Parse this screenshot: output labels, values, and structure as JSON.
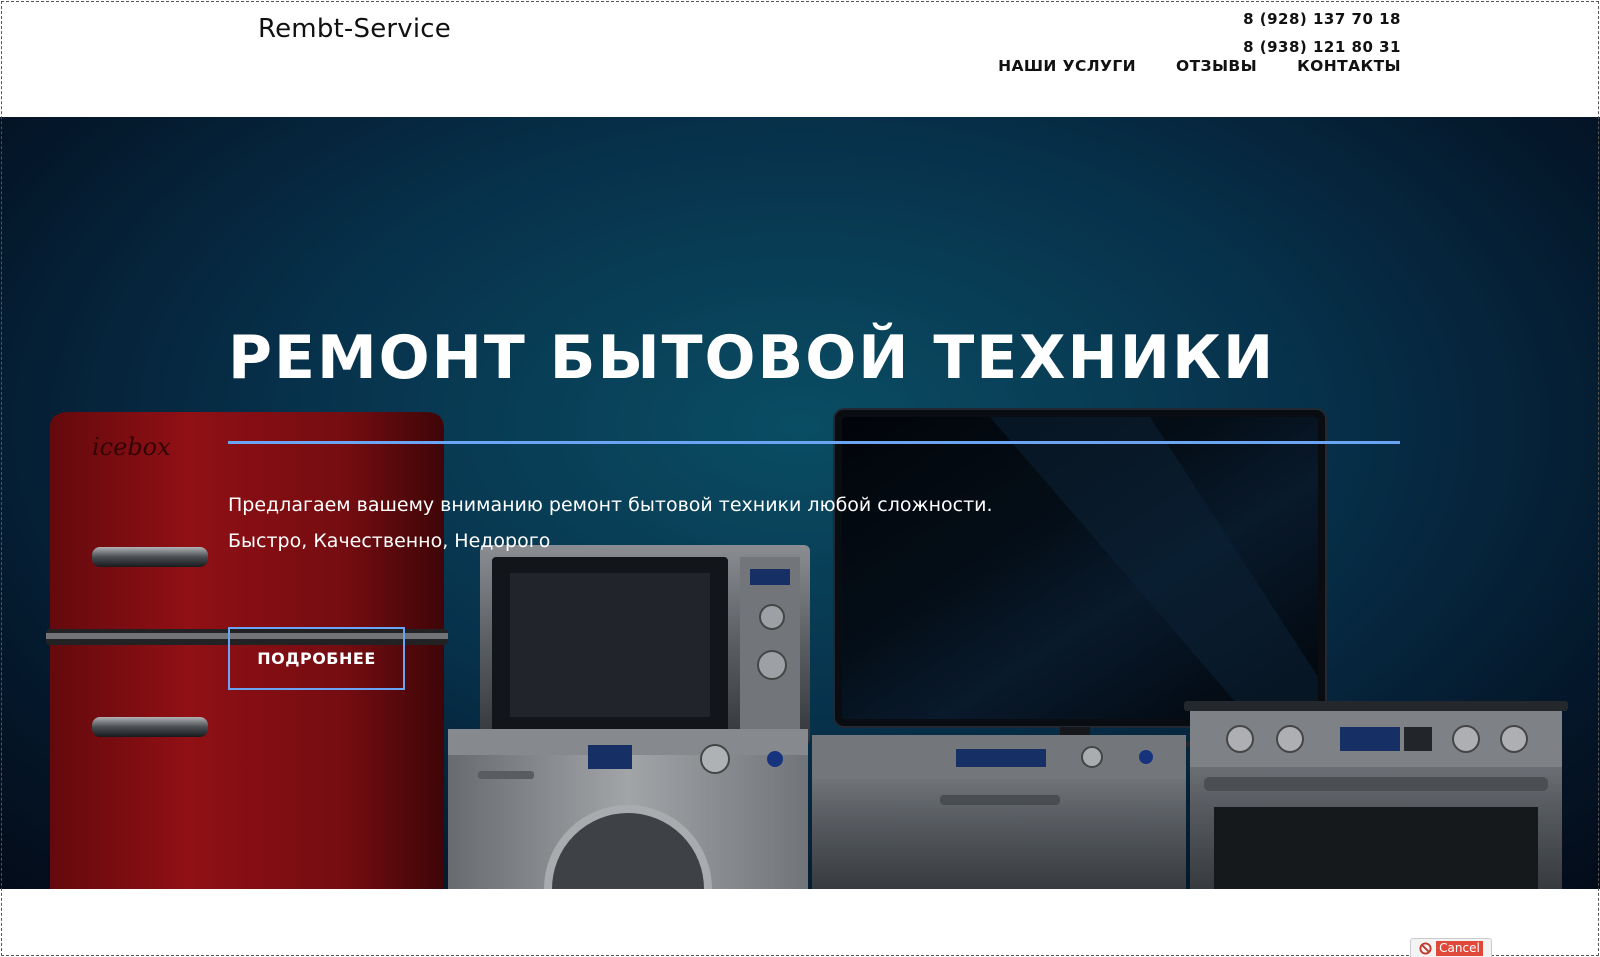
{
  "header": {
    "logo": "Rembt-Service",
    "phones": [
      "8 (928) 137 70 18",
      "8 (938) 121 80 31"
    ],
    "nav": [
      {
        "label": "НАШИ УСЛУГИ"
      },
      {
        "label": "ОТЗЫВЫ"
      },
      {
        "label": "КОНТАКТЫ"
      }
    ]
  },
  "hero": {
    "title": "РЕМОНТ БЫТОВОЙ ТЕХНИКИ",
    "lines": [
      "Предлагаем вашему вниманию ремонт бытовой техники любой сложности.",
      "Быстро, Качественно, Недорого"
    ],
    "button_label": "ПОДРОБНЕЕ",
    "fridge_brand": "icebox"
  },
  "cancel": {
    "label": "Cancel"
  },
  "colors": {
    "accent": "#6aa4f2",
    "fridge": "#b0141a",
    "hero_bg": "#093c5c"
  }
}
